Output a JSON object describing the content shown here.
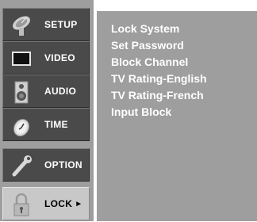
{
  "menu": {
    "items": [
      {
        "label": "SETUP",
        "icon": "satellite-dish-icon"
      },
      {
        "label": "VIDEO",
        "icon": "tv-screen-icon"
      },
      {
        "label": "AUDIO",
        "icon": "speaker-icon"
      },
      {
        "label": "TIME",
        "icon": "clock-icon"
      },
      {
        "label": "OPTION",
        "icon": "wrench-icon"
      },
      {
        "label": "LOCK",
        "icon": "padlock-icon",
        "selected": true,
        "arrow": "►"
      }
    ]
  },
  "lock_options": [
    "Lock System",
    "Set Password",
    "Block Channel",
    "TV Rating-English",
    "TV Rating-French",
    "Input Block"
  ],
  "colors": {
    "background": "#9e9e9e",
    "item": "#4a4a4a",
    "selected_item": "#c8c8c8",
    "text": "#ffffff"
  }
}
